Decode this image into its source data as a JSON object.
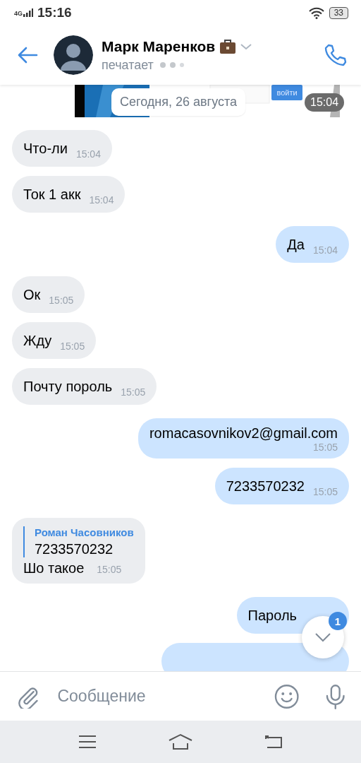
{
  "status_bar": {
    "network": "4G",
    "time": "15:16",
    "battery": "33"
  },
  "header": {
    "name": "Марк Маренков",
    "status": "печатает"
  },
  "attachment": {
    "kind": "picture",
    "button": "войти",
    "time": "15:04"
  },
  "date_label": "Сегодня, 26 августа",
  "messages": [
    {
      "kind": "incoming",
      "text": "Что-ли",
      "time": "15:04"
    },
    {
      "kind": "incoming",
      "text": "Ток 1 акк",
      "time": "15:04"
    },
    {
      "kind": "outgoing",
      "text": "Да",
      "time": "15:04"
    },
    {
      "kind": "incoming",
      "text": "Ок",
      "time": "15:05"
    },
    {
      "kind": "incoming",
      "text": "Жду",
      "time": "15:05"
    },
    {
      "kind": "incoming",
      "text": "Почту пороль",
      "time": "15:05"
    },
    {
      "kind": "outgoing",
      "text": "romacasovnikov2@gmail.com",
      "time": "15:05",
      "multiline": true
    },
    {
      "kind": "outgoing",
      "text": "7233570232",
      "time": "15:05"
    },
    {
      "kind": "incoming",
      "reply": {
        "author": "Роман Часовников",
        "text": "7233570232"
      },
      "text": "Шо такое",
      "time": "15:05"
    },
    {
      "kind": "outgoing",
      "text": "Пароль"
    },
    {
      "kind": "outgoing"
    }
  ],
  "scroll_button": {
    "badge": "1"
  },
  "composer": {
    "placeholder": "Сообщение"
  }
}
